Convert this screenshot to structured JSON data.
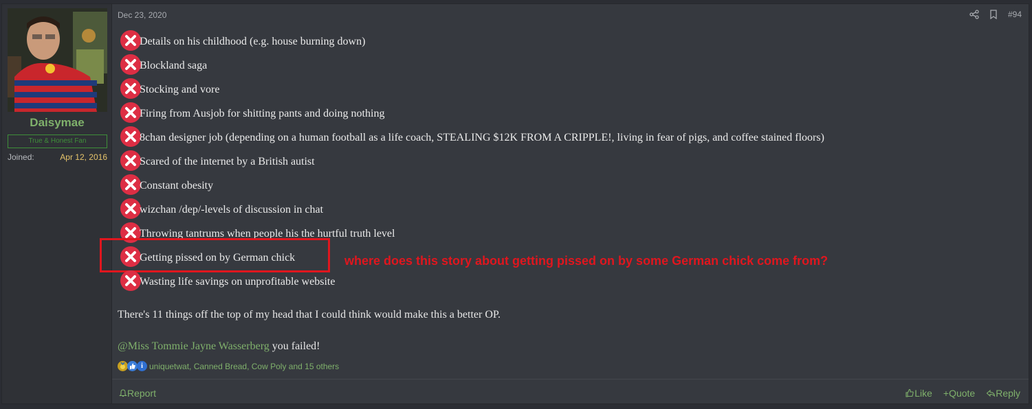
{
  "user": {
    "username": "Daisymae",
    "title": "True & Honest Fan",
    "joined_label": "Joined:",
    "joined_date": "Apr 12, 2016"
  },
  "post": {
    "date": "Dec 23, 2020",
    "number": "#94",
    "items": [
      "Details on his childhood (e.g. house burning down)",
      "Blockland saga",
      "Stocking and vore",
      "Firing from Ausjob for shitting pants and doing nothing",
      "8chan designer job (depending on a human football as a life coach, STEALING $12K FROM A CRIPPLE!, living in fear of pigs, and coffee stained floors)",
      "Scared of the internet by a British autist",
      "Constant obesity",
      "wizchan /dep/-levels of discussion in chat",
      "Throwing tantrums when people his the hurtful truth level",
      "Getting pissed on by German chick",
      "Wasting life savings on unprofitable website"
    ],
    "annotation": "where does this story about getting pissed on by some German chick come from?",
    "summary": "There's 11 things off the top of my head that I could think would make this a better OP.",
    "mention": "@Miss Tommie Jayne Wasserberg",
    "mention_suffix": " you failed!",
    "reactions_text": "uniquetwat, Canned Bread, Cow Poly and 15 others"
  },
  "actions": {
    "report": "Report",
    "like": "Like",
    "quote": "Quote",
    "reply": "Reply"
  },
  "colors": {
    "background": "#36393f",
    "accent_green": "#7fb06b",
    "highlight_red": "#e0161e",
    "xmark_red": "#dd2e44"
  }
}
